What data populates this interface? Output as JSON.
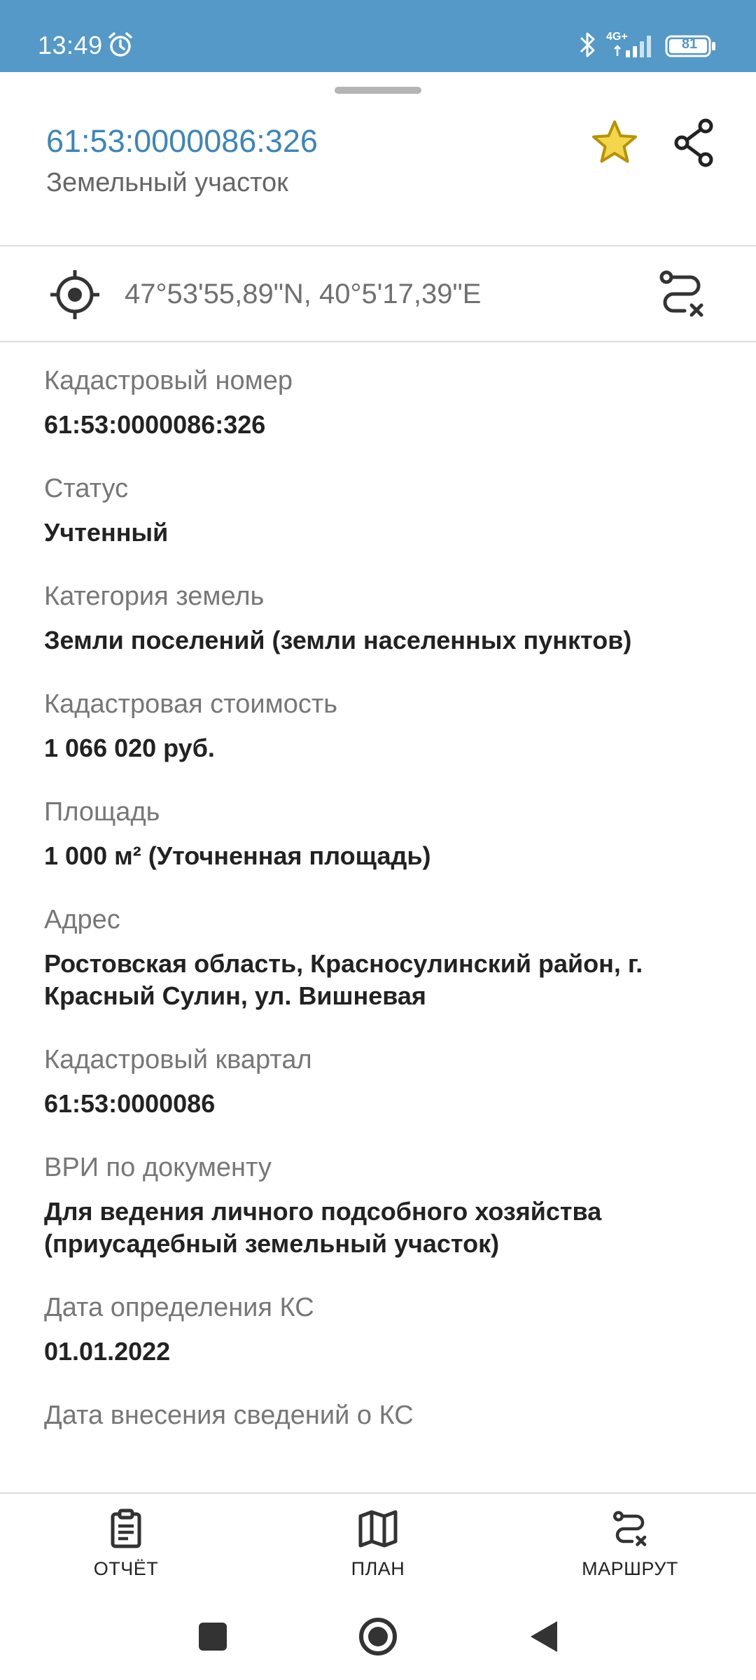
{
  "status_bar": {
    "time": "13:49",
    "network": "4G+",
    "battery": "81"
  },
  "header": {
    "title": "61:53:0000086:326",
    "subtitle": "Земельный участок",
    "star_color": "#e2b800"
  },
  "location": {
    "coordinates": "47°53'55,89\"N, 40°5'17,39\"E"
  },
  "fields": [
    {
      "label": "Кадастровый номер",
      "value": "61:53:0000086:326"
    },
    {
      "label": "Статус",
      "value": "Учтенный"
    },
    {
      "label": "Категория земель",
      "value": "Земли поселений (земли населенных пунктов)"
    },
    {
      "label": "Кадастровая стоимость",
      "value": "1 066 020 руб."
    },
    {
      "label": "Площадь",
      "value": "1 000 м² (Уточненная площадь)"
    },
    {
      "label": "Адрес",
      "value": "Ростовская область, Красносулинский район, г. Красный Сулин, ул. Вишневая"
    },
    {
      "label": "Кадастровый квартал",
      "value": "61:53:0000086"
    },
    {
      "label": "ВРИ по документу",
      "value": "Для ведения личного подсобного хозяйства (приусадебный земельный участок)"
    },
    {
      "label": "Дата определения КС",
      "value": "01.01.2022"
    },
    {
      "label": "Дата внесения сведений о КС",
      "value": ""
    }
  ],
  "bottom_nav": {
    "report": "ОТЧЁТ",
    "plan": "ПЛАН",
    "route": "МАРШРУТ"
  }
}
